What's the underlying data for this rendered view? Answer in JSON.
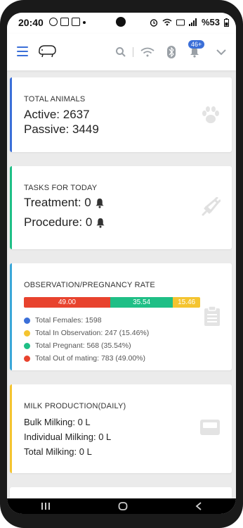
{
  "status_bar": {
    "time": "20:40",
    "battery": "%53",
    "icons": [
      "whatsapp-icon",
      "gallery-icon",
      "email-icon",
      "dot-icon",
      "alarm-icon",
      "wifi-icon",
      "volte-icon",
      "signal-icon",
      "battery-icon"
    ]
  },
  "header": {
    "notification_badge": "46+",
    "icons": [
      "menu-icon",
      "cow-logo",
      "search-icon",
      "wifi-icon",
      "bluetooth-icon",
      "bell-icon",
      "chevron-down-icon"
    ],
    "accent_color": "#3b6fd8"
  },
  "cards": {
    "total_animals": {
      "title": "TOTAL ANIMALS",
      "active": "Active: 2637",
      "passive": "Passive: 3449",
      "accent_color": "#3b6fd8",
      "icon": "paw-icon"
    },
    "tasks": {
      "title": "TASKS FOR TODAY",
      "treatment": "Treatment: 0",
      "procedure": "Procedure: 0",
      "accent_color": "#1fbf86",
      "icon": "syringe-icon"
    },
    "observation": {
      "title": "OBSERVATION/PREGNANCY RATE",
      "accent_color": "#3ba7d8",
      "icon": "clipboard-icon",
      "bar": [
        {
          "label": "49.00",
          "value": 49.0,
          "color": "#e8432e"
        },
        {
          "label": "35.54",
          "value": 35.54,
          "color": "#1fbf86"
        },
        {
          "label": "15.46",
          "value": 15.46,
          "color": "#f4c430"
        }
      ],
      "legend": [
        {
          "text": "Total Females: 1598",
          "color": "#3b6fd8"
        },
        {
          "text": "Total In Observation: 247 (15.46%)",
          "color": "#f4c430"
        },
        {
          "text": "Total Pregnant: 568 (35.54%)",
          "color": "#1fbf86"
        },
        {
          "text": "Total Out of mating: 783 (49.00%)",
          "color": "#e8432e"
        }
      ]
    },
    "milk": {
      "title": "MILK PRODUCTION(DAILY)",
      "bulk": "Bulk Milking: 0 L",
      "individual": "Individual Milking: 0 L",
      "total": "Total Milking: 0 L",
      "accent_color": "#f4c430",
      "icon": "milk-tray-icon"
    }
  }
}
